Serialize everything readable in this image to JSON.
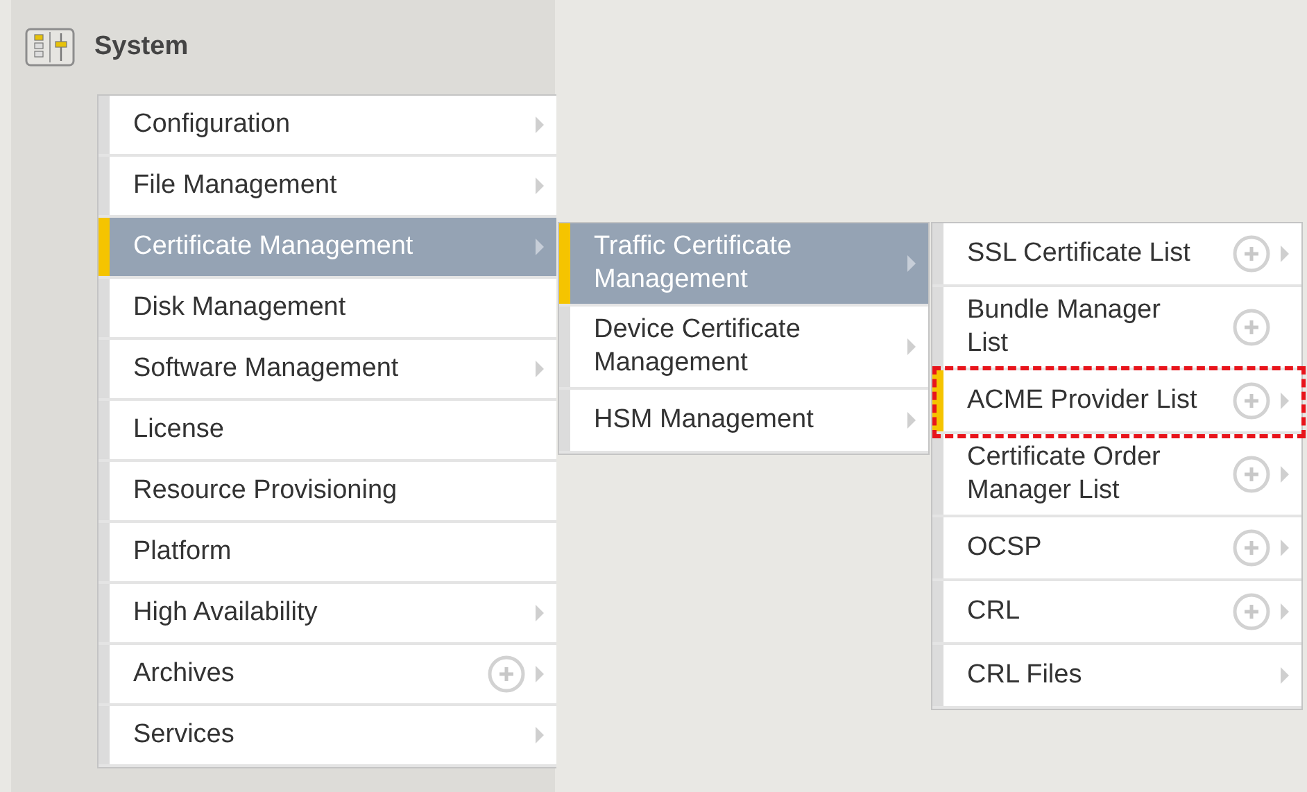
{
  "header": {
    "title": "System"
  },
  "menus": [
    {
      "items": [
        {
          "label": "Configuration",
          "selected": false,
          "open": false,
          "add": false,
          "submenu": true,
          "highlighted": false
        },
        {
          "label": "File Management",
          "selected": false,
          "open": false,
          "add": false,
          "submenu": true,
          "highlighted": false
        },
        {
          "label": "Certificate Management",
          "selected": true,
          "open": true,
          "add": false,
          "submenu": true,
          "highlighted": false
        },
        {
          "label": "Disk Management",
          "selected": false,
          "open": false,
          "add": false,
          "submenu": false,
          "highlighted": false
        },
        {
          "label": "Software Management",
          "selected": false,
          "open": false,
          "add": false,
          "submenu": true,
          "highlighted": false
        },
        {
          "label": "License",
          "selected": false,
          "open": false,
          "add": false,
          "submenu": false,
          "highlighted": false
        },
        {
          "label": "Resource Provisioning",
          "selected": false,
          "open": false,
          "add": false,
          "submenu": false,
          "highlighted": false
        },
        {
          "label": "Platform",
          "selected": false,
          "open": false,
          "add": false,
          "submenu": false,
          "highlighted": false
        },
        {
          "label": "High Availability",
          "selected": false,
          "open": false,
          "add": false,
          "submenu": true,
          "highlighted": false
        },
        {
          "label": "Archives",
          "selected": false,
          "open": false,
          "add": true,
          "submenu": true,
          "highlighted": false
        },
        {
          "label": "Services",
          "selected": false,
          "open": false,
          "add": false,
          "submenu": true,
          "highlighted": false
        }
      ]
    },
    {
      "items": [
        {
          "label": "Traffic Certificate Management",
          "selected": true,
          "open": true,
          "add": false,
          "submenu": true,
          "highlighted": false
        },
        {
          "label": "Device Certificate Management",
          "selected": false,
          "open": false,
          "add": false,
          "submenu": true,
          "highlighted": false
        },
        {
          "label": "HSM Management",
          "selected": false,
          "open": false,
          "add": false,
          "submenu": true,
          "highlighted": false
        }
      ]
    },
    {
      "items": [
        {
          "label": "SSL Certificate List",
          "selected": false,
          "open": false,
          "add": true,
          "submenu": true,
          "highlighted": false
        },
        {
          "label": "Bundle Manager List",
          "selected": false,
          "open": false,
          "add": true,
          "submenu": false,
          "highlighted": false
        },
        {
          "label": "ACME Provider List",
          "selected": true,
          "open": false,
          "add": true,
          "submenu": true,
          "highlighted": true
        },
        {
          "label": "Certificate Order Manager List",
          "selected": false,
          "open": false,
          "add": true,
          "submenu": true,
          "highlighted": false
        },
        {
          "label": "OCSP",
          "selected": false,
          "open": false,
          "add": true,
          "submenu": true,
          "highlighted": false
        },
        {
          "label": "CRL",
          "selected": false,
          "open": false,
          "add": true,
          "submenu": true,
          "highlighted": false
        },
        {
          "label": "CRL Files",
          "selected": false,
          "open": false,
          "add": false,
          "submenu": true,
          "highlighted": false
        }
      ]
    }
  ]
}
